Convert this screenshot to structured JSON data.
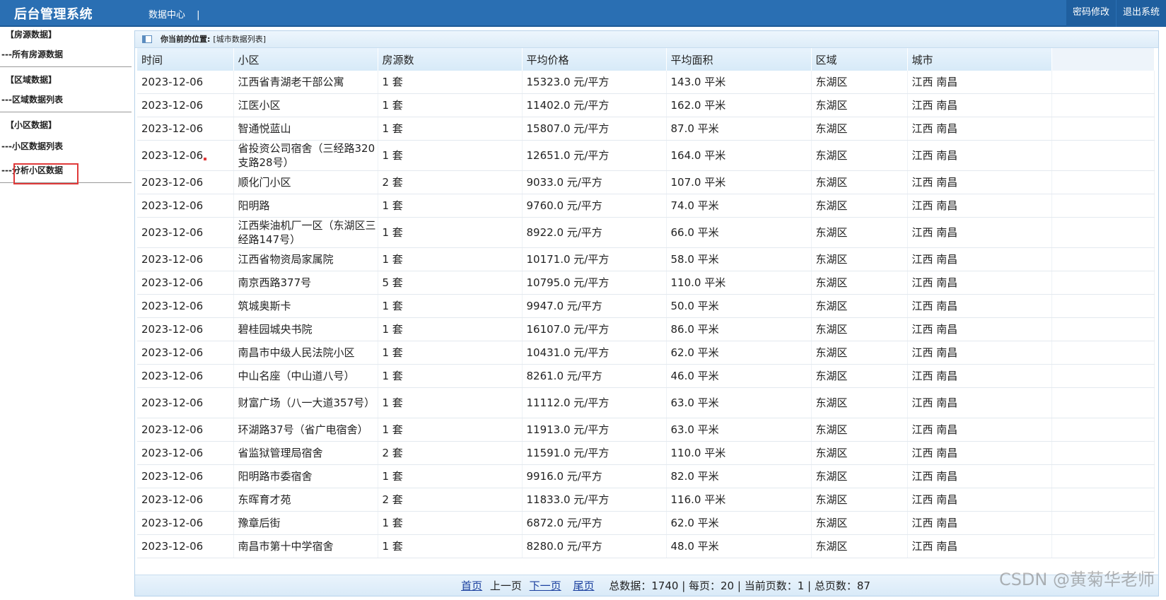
{
  "header": {
    "brand": "后台管理系统",
    "nav": "数据中心",
    "nav_sep": "|",
    "actions": [
      "密码修改",
      "退出系统"
    ]
  },
  "sidebar": {
    "groups": [
      {
        "title": "【房源数据】",
        "links": [
          "---所有房源数据"
        ]
      },
      {
        "title": "【区域数据】",
        "links": [
          "---区域数据列表"
        ]
      },
      {
        "title": "【小区数据】",
        "links": [
          "---小区数据列表",
          "---分析小区数据"
        ]
      }
    ]
  },
  "location": {
    "label": "你当前的位置:",
    "value": "[城市数据列表]"
  },
  "table": {
    "headers": [
      "时间",
      "小区",
      "房源数",
      "平均价格",
      "平均面积",
      "区域",
      "城市"
    ],
    "rows": [
      [
        "2023-12-06",
        "江西省青湖老干部公寓",
        "1 套",
        "15323.0 元/平方",
        "143.0 平米",
        "东湖区",
        "江西 南昌"
      ],
      [
        "2023-12-06",
        "江医小区",
        "1 套",
        "11402.0 元/平方",
        "162.0 平米",
        "东湖区",
        "江西 南昌"
      ],
      [
        "2023-12-06",
        "智通悦蓝山",
        "1 套",
        "15807.0 元/平方",
        "87.0 平米",
        "东湖区",
        "江西 南昌"
      ],
      [
        "2023-12-06",
        "省投资公司宿舍（三经路320支路28号）",
        "1 套",
        "12651.0 元/平方",
        "164.0 平米",
        "东湖区",
        "江西 南昌"
      ],
      [
        "2023-12-06",
        "顺化门小区",
        "2 套",
        "9033.0 元/平方",
        "107.0 平米",
        "东湖区",
        "江西 南昌"
      ],
      [
        "2023-12-06",
        "阳明路",
        "1 套",
        "9760.0 元/平方",
        "74.0 平米",
        "东湖区",
        "江西 南昌"
      ],
      [
        "2023-12-06",
        "江西柴油机厂一区（东湖区三经路147号）",
        "1 套",
        "8922.0 元/平方",
        "66.0 平米",
        "东湖区",
        "江西 南昌"
      ],
      [
        "2023-12-06",
        "江西省物资局家属院",
        "1 套",
        "10171.0 元/平方",
        "58.0 平米",
        "东湖区",
        "江西 南昌"
      ],
      [
        "2023-12-06",
        "南京西路377号",
        "5 套",
        "10795.0 元/平方",
        "110.0 平米",
        "东湖区",
        "江西 南昌"
      ],
      [
        "2023-12-06",
        "筑城奥斯卡",
        "1 套",
        "9947.0 元/平方",
        "50.0 平米",
        "东湖区",
        "江西 南昌"
      ],
      [
        "2023-12-06",
        "碧桂园城央书院",
        "1 套",
        "16107.0 元/平方",
        "86.0 平米",
        "东湖区",
        "江西 南昌"
      ],
      [
        "2023-12-06",
        "南昌市中级人民法院小区",
        "1 套",
        "10431.0 元/平方",
        "62.0 平米",
        "东湖区",
        "江西 南昌"
      ],
      [
        "2023-12-06",
        "中山名座（中山道八号）",
        "1 套",
        "8261.0 元/平方",
        "46.0 平米",
        "东湖区",
        "江西 南昌"
      ],
      [
        "2023-12-06",
        "财富广场（八一大道357号）",
        "1 套",
        "11112.0 元/平方",
        "63.0 平米",
        "东湖区",
        "江西 南昌"
      ],
      [
        "2023-12-06",
        "环湖路37号（省广电宿舍）",
        "1 套",
        "11913.0 元/平方",
        "63.0 平米",
        "东湖区",
        "江西 南昌"
      ],
      [
        "2023-12-06",
        "省监狱管理局宿舍",
        "2 套",
        "11591.0 元/平方",
        "110.0 平米",
        "东湖区",
        "江西 南昌"
      ],
      [
        "2023-12-06",
        "阳明路市委宿舍",
        "1 套",
        "9916.0 元/平方",
        "82.0 平米",
        "东湖区",
        "江西 南昌"
      ],
      [
        "2023-12-06",
        "东晖育才苑",
        "2 套",
        "11833.0 元/平方",
        "116.0 平米",
        "东湖区",
        "江西 南昌"
      ],
      [
        "2023-12-06",
        "豫章后街",
        "1 套",
        "6872.0 元/平方",
        "62.0 平米",
        "东湖区",
        "江西 南昌"
      ],
      [
        "2023-12-06",
        "南昌市第十中学宿舍",
        "1 套",
        "8280.0 元/平方",
        "48.0 平米",
        "东湖区",
        "江西 南昌"
      ]
    ]
  },
  "pager": {
    "first": "首页",
    "prev": "上一页",
    "next": "下一页",
    "last": "尾页",
    "summary": "总数据：1740 | 每页：20 | 当前页数：1 | 总页数：87"
  },
  "watermark": "CSDN @黄菊华老师",
  "colors": {
    "header_bg": "#2a6fb3",
    "action_bg": "#1f5f9f",
    "highlight_border": "#e03a3a",
    "link": "#1a3f9e"
  }
}
